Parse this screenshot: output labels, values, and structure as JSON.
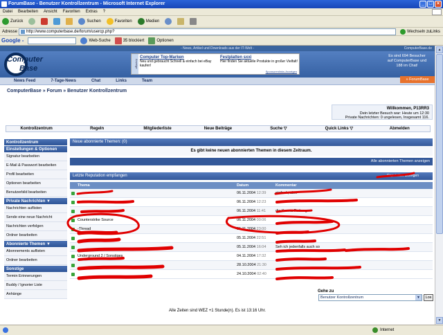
{
  "window": {
    "title": "ForumBase - Benutzer Kontrollzentrum - Microsoft Internet Explorer"
  },
  "menu": [
    "Datei",
    "Bearbeiten",
    "Ansicht",
    "Favoriten",
    "Extras",
    "?"
  ],
  "toolbar": {
    "back": "Zurück",
    "search": "Suchen",
    "favorites": "Favoriten",
    "media": "Medien"
  },
  "address": {
    "label": "Adresse",
    "url": "http://www.computerbase.de/forum/usercp.php?",
    "go": "Wechseln zu",
    "links": "Links"
  },
  "google": {
    "logo": "Google -",
    "web_search": "Web-Suche",
    "blocked": "35 blockiert",
    "options": "Optionen"
  },
  "site": {
    "news_line": "- News, Artikel und Downloads aus der IT-Welt -",
    "news_right": "ComputerBase.de",
    "logo_top": "Computer",
    "logo_bottom": "Base",
    "ad_side": "Anzeige",
    "ad1_title": "Computer Top-Marken",
    "ad1_text": "Neu und gebraucht Schnell & einfach bei eBay kaufen!",
    "ad2_title": "Festplatten sxxi",
    "ad2_text": "Hier finden Sie aktuelle Produkte in großer Vielfalt!",
    "ad_footer": "Sponsorenlinks-Anzeigen",
    "stats_line1": "Es sind 694 Besucher",
    "stats_line2": "auf ComputerBase und",
    "stats_line3": "188 im Chat!",
    "nav": [
      "News Feed",
      "7-Tage-News",
      "Chat",
      "Links",
      "Team"
    ],
    "forumbase_tab": "» ForumBase"
  },
  "breadcrumb": "ComputerBase » Forum » Benutzer Kontrollzentrum",
  "welcome": {
    "greeting": "Willkommen, P13RR3",
    "last_visit": "Dein letzter Besuch war: Heute um 12:30",
    "pm": "Private Nachrichten: 0 ungelesen, Insgesamt 116."
  },
  "mainnav": [
    "Kontrollzentrum",
    "Regeln",
    "Mitgliederliste",
    "Neue Beiträge",
    "Suche ▽",
    "Quick Links ▽",
    "Abmelden"
  ],
  "sidebar": [
    {
      "type": "head",
      "label": "Kontrollzentrum"
    },
    {
      "type": "head",
      "label": "Einstellungen & Optionen"
    },
    {
      "type": "item",
      "label": "Signatur bearbeiten"
    },
    {
      "type": "item",
      "label": "E-Mail & Passwort bearbeiten"
    },
    {
      "type": "item",
      "label": "Profil bearbeiten"
    },
    {
      "type": "item",
      "label": "Optionen bearbeiten"
    },
    {
      "type": "item",
      "label": "Benutzerbild bearbeiten"
    },
    {
      "type": "head",
      "label": "Private Nachrichten ▼"
    },
    {
      "type": "item",
      "label": "Nachrichten auflisten"
    },
    {
      "type": "item",
      "label": "Sende eine neue Nachricht"
    },
    {
      "type": "item",
      "label": "Nachrichten verfolgen"
    },
    {
      "type": "item",
      "label": "Ordner bearbeiten"
    },
    {
      "type": "head",
      "label": "Abonnierte Themen ▼"
    },
    {
      "type": "item",
      "label": "Abonnements auflisten"
    },
    {
      "type": "item",
      "label": "Ordner bearbeiten"
    },
    {
      "type": "head",
      "label": "Sonstige"
    },
    {
      "type": "item",
      "label": "Termin Erinnerungen"
    },
    {
      "type": "item",
      "label": "Buddy / Ignorier Liste"
    },
    {
      "type": "item",
      "label": "Anhänge"
    }
  ],
  "box1": {
    "title": "Neue abonnierte Themen: (0)",
    "message": "Es gibt keine neuen abonnierten Themen in diesem Zeitraum.",
    "footer_link": "Alle abonnierten Themen anzeigen"
  },
  "box2": {
    "title": "Letzte Reputation empfangen",
    "action": "Reputation anzeigen"
  },
  "table": {
    "headers": [
      "Thema",
      "Datum",
      "Kommentar"
    ],
    "rows": [
      {
        "topic": "",
        "date": "06.11.2004",
        "time": "12:39",
        "comment": "einfach, aber"
      },
      {
        "topic": "",
        "date": "06.11.2004",
        "time": "12:23",
        "comment": ""
      },
      {
        "topic": "",
        "date": "06.11.2004",
        "time": "11:41",
        "comment": "die Karma Rettung"
      },
      {
        "topic": "Counterstrike Source",
        "date": "06.11.2004",
        "time": "00:06",
        "comment": ""
      },
      {
        "topic": "-Thread",
        "date": "05.11.2004",
        "time": "23:00",
        "comment": ""
      },
      {
        "topic": "",
        "date": "05.11.2004",
        "time": "22:51",
        "comment": ""
      },
      {
        "topic": "",
        "date": "05.11.2004",
        "time": "16:04",
        "comment": "Seh ich jedenfalls auch so"
      },
      {
        "topic": "Underground 2 / Sonstiges",
        "date": "04.11.2004",
        "time": "17:32",
        "comment": ""
      },
      {
        "topic": "",
        "date": "28.10.2004",
        "time": "21:30",
        "comment": ""
      },
      {
        "topic": "",
        "date": "24.10.2004",
        "time": "02:40",
        "comment": ""
      }
    ]
  },
  "goto": {
    "label": "Gehe zu",
    "selected": "Benutzer Kontrollzentrum",
    "button": "Los"
  },
  "timezone": "Alle Zeiten sind WEZ +1 Stunde(n). Es ist 13:16 Uhr.",
  "status": {
    "zone": "Internet"
  }
}
